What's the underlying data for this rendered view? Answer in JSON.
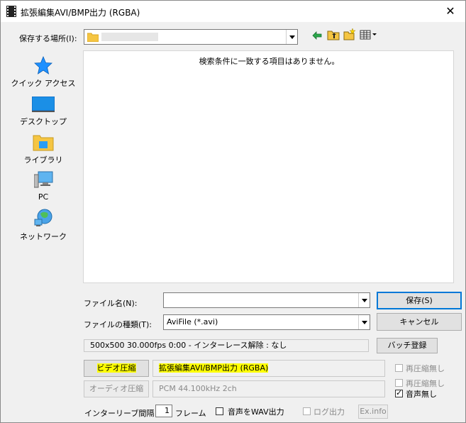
{
  "window": {
    "title": "拡張編集AVI/BMP出力 (RGBA)",
    "close_glyph": "✕"
  },
  "location": {
    "label": "保存する場所(I):",
    "value": ""
  },
  "file_list": {
    "empty_message": "検索条件に一致する項目はありません。"
  },
  "places": [
    {
      "label": "クイック アクセス",
      "icon": "star-icon"
    },
    {
      "label": "デスクトップ",
      "icon": "desktop-icon"
    },
    {
      "label": "ライブラリ",
      "icon": "library-icon"
    },
    {
      "label": "PC",
      "icon": "computer-icon"
    },
    {
      "label": "ネットワーク",
      "icon": "network-icon"
    }
  ],
  "filename": {
    "label": "ファイル名(N):",
    "value": ""
  },
  "filetype": {
    "label": "ファイルの種類(T):",
    "value": "AviFile (*.avi)"
  },
  "buttons": {
    "save": "保存(S)",
    "cancel": "キャンセル",
    "batch": "バッチ登録",
    "video_compress": "ビデオ圧縮",
    "audio_compress": "オーディオ圧縮",
    "exinfo": "Ex.info"
  },
  "info": {
    "video_summary": "500x500  30.000fps  0:00  -  インターレース解除 : なし",
    "video_codec": "拡張編集AVI/BMP出力 (RGBA)",
    "audio_codec": "PCM 44.100kHz 2ch"
  },
  "checkboxes": {
    "recompress_video": {
      "label": "再圧縮無し",
      "checked": false
    },
    "recompress_audio": {
      "label": "再圧縮無し",
      "checked": false
    },
    "no_audio": {
      "label": "音声無し",
      "checked": true
    },
    "audio_wav": {
      "label": "音声をWAV出力",
      "checked": false
    },
    "log_output": {
      "label": "ログ出力",
      "checked": false
    }
  },
  "interleave": {
    "label": "インターリーブ間隔 :",
    "value": "1",
    "unit": "フレーム"
  },
  "colors": {
    "highlight": "#ffff00",
    "focus_border": "#0078d7"
  }
}
